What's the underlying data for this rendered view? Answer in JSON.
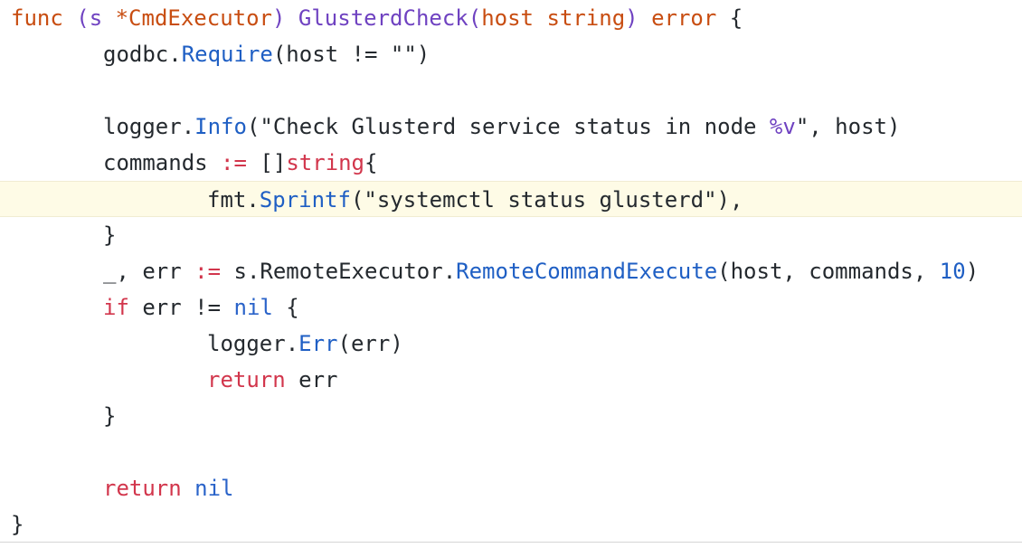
{
  "editor": {
    "language": "Go",
    "active_line_index": 5,
    "lines": [
      {
        "indent": 0,
        "tokens": [
          {
            "text": "func ",
            "cls": "kw-orange"
          },
          {
            "text": "(s ",
            "cls": "recv-purple"
          },
          {
            "text": "*CmdExecutor",
            "cls": "kw-orange"
          },
          {
            "text": ") ",
            "cls": "recv-purple"
          },
          {
            "text": "GlusterdCheck",
            "cls": "func-purple"
          },
          {
            "text": "(",
            "cls": "recv-purple"
          },
          {
            "text": "host string",
            "cls": "kw-orange"
          },
          {
            "text": ") ",
            "cls": "recv-purple"
          },
          {
            "text": "error",
            "cls": "kw-orange"
          },
          {
            "text": " {",
            "cls": "plain"
          }
        ]
      },
      {
        "indent": 1,
        "tokens": [
          {
            "text": "godbc.",
            "cls": "plain"
          },
          {
            "text": "Require",
            "cls": "call-blue"
          },
          {
            "text": "(host != \"\")",
            "cls": "plain"
          }
        ]
      },
      {
        "indent": 0,
        "tokens": []
      },
      {
        "indent": 1,
        "tokens": [
          {
            "text": "logger.",
            "cls": "plain"
          },
          {
            "text": "Info",
            "cls": "call-blue"
          },
          {
            "text": "(\"Check Glusterd service status in node ",
            "cls": "str"
          },
          {
            "text": "%v",
            "cls": "func-purple"
          },
          {
            "text": "\", host)",
            "cls": "plain"
          }
        ]
      },
      {
        "indent": 1,
        "tokens": [
          {
            "text": "commands ",
            "cls": "plain"
          },
          {
            "text": ":=",
            "cls": "op-red"
          },
          {
            "text": " []",
            "cls": "plain"
          },
          {
            "text": "string",
            "cls": "kw-red"
          },
          {
            "text": "{",
            "cls": "plain"
          }
        ]
      },
      {
        "indent": 2,
        "tokens": [
          {
            "text": "fmt.",
            "cls": "plain"
          },
          {
            "text": "Sprintf",
            "cls": "call-blue"
          },
          {
            "text": "(\"systemctl status glusterd\"),",
            "cls": "plain"
          }
        ]
      },
      {
        "indent": 1,
        "tokens": [
          {
            "text": "}",
            "cls": "plain"
          }
        ]
      },
      {
        "indent": 1,
        "tokens": [
          {
            "text": "_, err ",
            "cls": "plain"
          },
          {
            "text": ":=",
            "cls": "op-red"
          },
          {
            "text": " s.RemoteExecutor.",
            "cls": "plain"
          },
          {
            "text": "RemoteCommandExecute",
            "cls": "call-blue"
          },
          {
            "text": "(host, commands, ",
            "cls": "plain"
          },
          {
            "text": "10",
            "cls": "num"
          },
          {
            "text": ")",
            "cls": "plain"
          }
        ]
      },
      {
        "indent": 1,
        "tokens": [
          {
            "text": "if",
            "cls": "kw-red"
          },
          {
            "text": " err != ",
            "cls": "plain"
          },
          {
            "text": "nil",
            "cls": "kw-blue"
          },
          {
            "text": " {",
            "cls": "plain"
          }
        ]
      },
      {
        "indent": 2,
        "tokens": [
          {
            "text": "logger.",
            "cls": "plain"
          },
          {
            "text": "Err",
            "cls": "call-blue"
          },
          {
            "text": "(err)",
            "cls": "plain"
          }
        ]
      },
      {
        "indent": 2,
        "tokens": [
          {
            "text": "return",
            "cls": "kw-red"
          },
          {
            "text": " err",
            "cls": "plain"
          }
        ]
      },
      {
        "indent": 1,
        "tokens": [
          {
            "text": "}",
            "cls": "plain"
          }
        ]
      },
      {
        "indent": 0,
        "tokens": []
      },
      {
        "indent": 1,
        "tokens": [
          {
            "text": "return",
            "cls": "kw-red"
          },
          {
            "text": " ",
            "cls": "plain"
          },
          {
            "text": "nil",
            "cls": "kw-blue"
          }
        ]
      },
      {
        "indent": 0,
        "tokens": [
          {
            "text": "}",
            "cls": "plain"
          }
        ]
      }
    ]
  },
  "colors": {
    "keyword_orange": "#c84d11",
    "keyword_red": "#d2364c",
    "call_blue": "#1f5fc4",
    "function_purple": "#6f42c1",
    "active_line_background": "#fefbe6",
    "plain_text": "#24292e"
  }
}
